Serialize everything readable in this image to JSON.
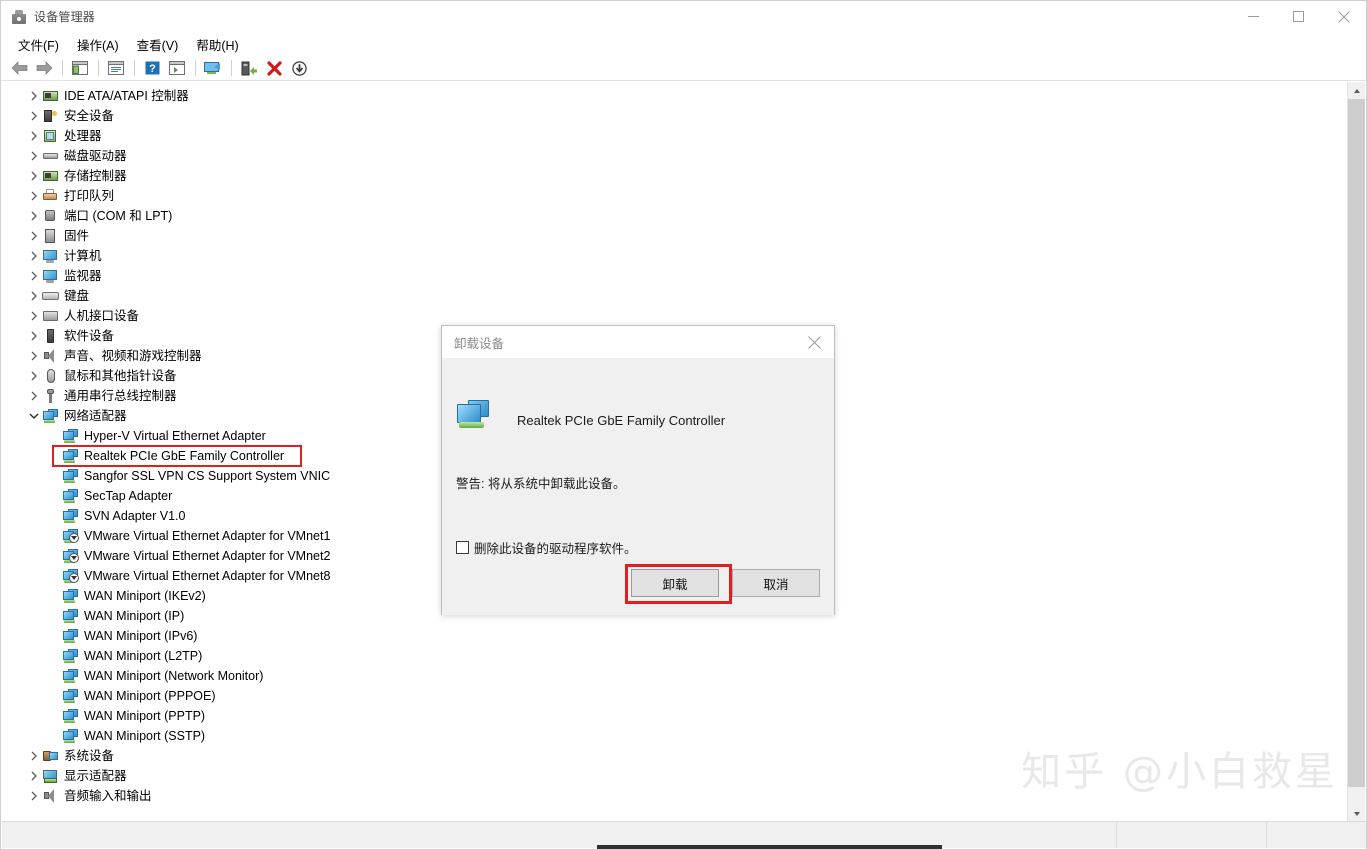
{
  "window": {
    "title": "设备管理器",
    "icon": "device-manager-icon",
    "controls": {
      "minimize": "minimize-icon",
      "maximize": "maximize-icon",
      "close": "close-icon"
    }
  },
  "menubar": {
    "items": [
      {
        "label": "文件(F)"
      },
      {
        "label": "操作(A)"
      },
      {
        "label": "查看(V)"
      },
      {
        "label": "帮助(H)"
      }
    ]
  },
  "toolbar": {
    "buttons": [
      {
        "name": "back-icon",
        "glyph": "back"
      },
      {
        "name": "forward-icon",
        "glyph": "forward"
      },
      {
        "name": "separator-1",
        "glyph": "sep"
      },
      {
        "name": "show-hide-console-tree-icon",
        "glyph": "tree"
      },
      {
        "name": "separator-2",
        "glyph": "sep"
      },
      {
        "name": "properties-icon",
        "glyph": "props"
      },
      {
        "name": "separator-3",
        "glyph": "sep"
      },
      {
        "name": "help-icon",
        "glyph": "help"
      },
      {
        "name": "show-details-icon",
        "glyph": "details"
      },
      {
        "name": "separator-4",
        "glyph": "sep"
      },
      {
        "name": "scan-hardware-changes-icon",
        "glyph": "scan"
      },
      {
        "name": "separator-5",
        "glyph": "sep"
      },
      {
        "name": "update-driver-icon",
        "glyph": "update"
      },
      {
        "name": "uninstall-device-icon",
        "glyph": "uninstall"
      },
      {
        "name": "disable-device-icon",
        "glyph": "disable"
      }
    ]
  },
  "tree": {
    "nodes": [
      {
        "label": "IDE ATA/ATAPI 控制器",
        "level": 1,
        "expanded": false,
        "icon": "ide-controller-icon"
      },
      {
        "label": "安全设备",
        "level": 1,
        "expanded": false,
        "icon": "security-device-icon"
      },
      {
        "label": "处理器",
        "level": 1,
        "expanded": false,
        "icon": "processor-icon"
      },
      {
        "label": "磁盘驱动器",
        "level": 1,
        "expanded": false,
        "icon": "disk-drive-icon"
      },
      {
        "label": "存储控制器",
        "level": 1,
        "expanded": false,
        "icon": "storage-controller-icon"
      },
      {
        "label": "打印队列",
        "level": 1,
        "expanded": false,
        "icon": "print-queue-icon"
      },
      {
        "label": "端口 (COM 和 LPT)",
        "level": 1,
        "expanded": false,
        "icon": "ports-icon"
      },
      {
        "label": "固件",
        "level": 1,
        "expanded": false,
        "icon": "firmware-icon"
      },
      {
        "label": "计算机",
        "level": 1,
        "expanded": false,
        "icon": "computer-icon"
      },
      {
        "label": "监视器",
        "level": 1,
        "expanded": false,
        "icon": "monitor-icon"
      },
      {
        "label": "键盘",
        "level": 1,
        "expanded": false,
        "icon": "keyboard-icon"
      },
      {
        "label": "人机接口设备",
        "level": 1,
        "expanded": false,
        "icon": "hid-icon"
      },
      {
        "label": "软件设备",
        "level": 1,
        "expanded": false,
        "icon": "software-device-icon"
      },
      {
        "label": "声音、视频和游戏控制器",
        "level": 1,
        "expanded": false,
        "icon": "sound-video-game-icon"
      },
      {
        "label": "鼠标和其他指针设备",
        "level": 1,
        "expanded": false,
        "icon": "mouse-icon"
      },
      {
        "label": "通用串行总线控制器",
        "level": 1,
        "expanded": false,
        "icon": "usb-controller-icon"
      },
      {
        "label": "网络适配器",
        "level": 1,
        "expanded": true,
        "icon": "network-adapter-icon"
      },
      {
        "label": "Hyper-V Virtual Ethernet Adapter",
        "level": 2,
        "icon": "network-adapter-icon"
      },
      {
        "label": "Realtek PCIe GbE Family Controller",
        "level": 2,
        "icon": "network-adapter-icon",
        "highlighted": true
      },
      {
        "label": "Sangfor SSL VPN CS Support System VNIC",
        "level": 2,
        "icon": "network-adapter-icon"
      },
      {
        "label": "SecTap Adapter",
        "level": 2,
        "icon": "network-adapter-icon"
      },
      {
        "label": "SVN Adapter V1.0",
        "level": 2,
        "icon": "network-adapter-icon"
      },
      {
        "label": "VMware Virtual Ethernet Adapter for VMnet1",
        "level": 2,
        "icon": "network-adapter-disabled-icon",
        "disabled": true
      },
      {
        "label": "VMware Virtual Ethernet Adapter for VMnet2",
        "level": 2,
        "icon": "network-adapter-disabled-icon",
        "disabled": true
      },
      {
        "label": "VMware Virtual Ethernet Adapter for VMnet8",
        "level": 2,
        "icon": "network-adapter-disabled-icon",
        "disabled": true
      },
      {
        "label": "WAN Miniport (IKEv2)",
        "level": 2,
        "icon": "network-adapter-icon"
      },
      {
        "label": "WAN Miniport (IP)",
        "level": 2,
        "icon": "network-adapter-icon"
      },
      {
        "label": "WAN Miniport (IPv6)",
        "level": 2,
        "icon": "network-adapter-icon"
      },
      {
        "label": "WAN Miniport (L2TP)",
        "level": 2,
        "icon": "network-adapter-icon"
      },
      {
        "label": "WAN Miniport (Network Monitor)",
        "level": 2,
        "icon": "network-adapter-icon"
      },
      {
        "label": "WAN Miniport (PPPOE)",
        "level": 2,
        "icon": "network-adapter-icon"
      },
      {
        "label": "WAN Miniport (PPTP)",
        "level": 2,
        "icon": "network-adapter-icon"
      },
      {
        "label": "WAN Miniport (SSTP)",
        "level": 2,
        "icon": "network-adapter-icon"
      },
      {
        "label": "系统设备",
        "level": 1,
        "expanded": false,
        "icon": "system-device-icon"
      },
      {
        "label": "显示适配器",
        "level": 1,
        "expanded": false,
        "icon": "display-adapter-icon"
      },
      {
        "label": "音频输入和输出",
        "level": 1,
        "expanded": false,
        "icon": "audio-io-icon"
      }
    ]
  },
  "dialog": {
    "title": "卸载设备",
    "close_icon": "close-icon",
    "device_icon": "network-adapter-icon",
    "device_name": "Realtek PCIe GbE Family Controller",
    "warning": "警告: 将从系统中卸载此设备。",
    "checkbox": {
      "label": "删除此设备的驱动程序软件。",
      "checked": false
    },
    "buttons": {
      "confirm": "卸载",
      "cancel": "取消"
    }
  },
  "watermark": "知乎 @小白救星",
  "colors": {
    "highlight": "#e02020",
    "accent_blue": "#2f8fd0",
    "dialog_bg": "#f0f0f0",
    "window_bg": "#ffffff"
  }
}
